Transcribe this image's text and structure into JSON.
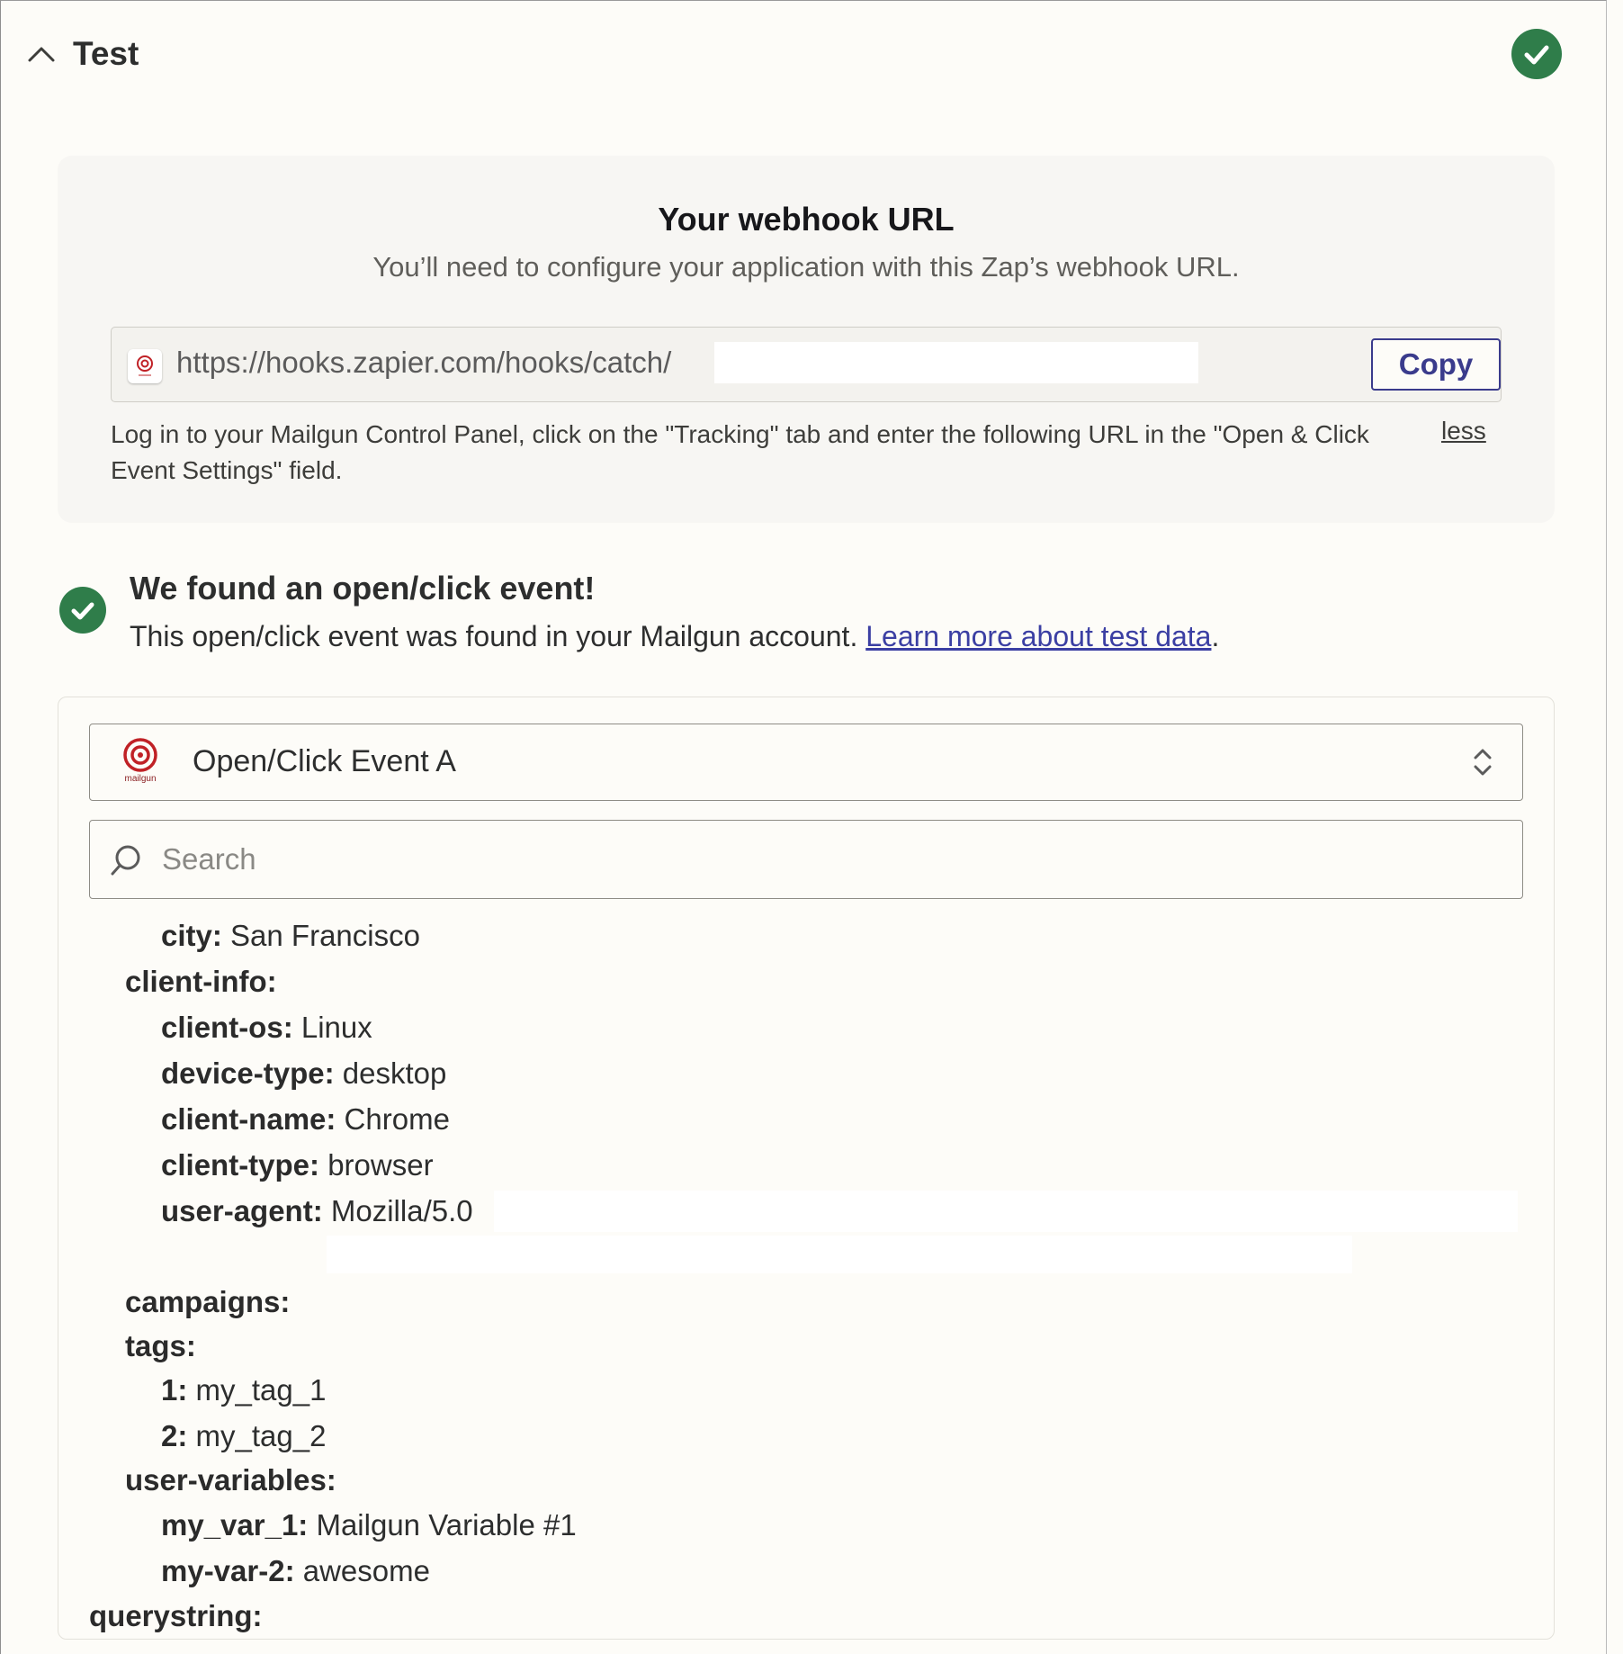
{
  "section": {
    "title": "Test"
  },
  "webhook": {
    "title": "Your webhook URL",
    "subtitle": "You’ll need to configure your application with this Zap’s webhook URL.",
    "url": "https://hooks.zapier.com/hooks/catch/",
    "copy_label": "Copy",
    "help_text": "Log in to your Mailgun Control Panel, click on the \"Tracking\" tab and enter the following URL in the \"Open & Click Event Settings\" field.",
    "less_label": "less"
  },
  "found": {
    "title": "We found an open/click event!",
    "subtitle": "This open/click event was found in your Mailgun account. ",
    "link": "Learn more about test data",
    "suffix": "."
  },
  "event_select": {
    "value": "Open/Click Event A",
    "logo_text": "mailgun"
  },
  "search": {
    "placeholder": "Search"
  },
  "data_rows": [
    {
      "key": "city:",
      "value": "San Francisco"
    },
    {
      "key": "client-info:",
      "value": ""
    },
    {
      "key": "client-os:",
      "value": "Linux"
    },
    {
      "key": "device-type:",
      "value": "desktop"
    },
    {
      "key": "client-name:",
      "value": "Chrome"
    },
    {
      "key": "client-type:",
      "value": "browser"
    },
    {
      "key": "user-agent:",
      "value": "Mozilla/5.0"
    },
    {
      "key": "campaigns:",
      "value": ""
    },
    {
      "key": "tags:",
      "value": ""
    },
    {
      "key": "1:",
      "value": "my_tag_1"
    },
    {
      "key": "2:",
      "value": "my_tag_2"
    },
    {
      "key": "user-variables:",
      "value": ""
    },
    {
      "key": "my_var_1:",
      "value": "Mailgun Variable #1"
    },
    {
      "key": "my-var-2:",
      "value": "awesome"
    },
    {
      "key": "querystring:",
      "value": ""
    }
  ],
  "colors": {
    "success": "#2f7d4a",
    "link": "#3b3fa3",
    "button_border": "#3a3b8c",
    "mailgun": "#c02126"
  }
}
